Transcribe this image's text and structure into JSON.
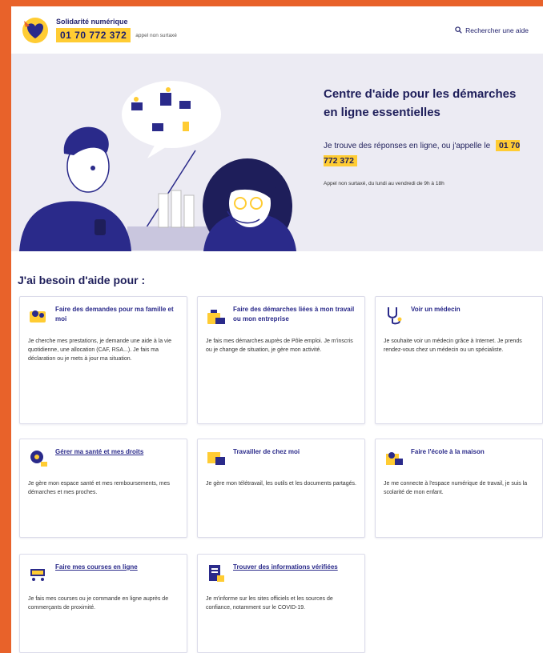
{
  "header": {
    "brand_title": "Solidarité numérique",
    "phone": "01 70 772 372",
    "phone_note": "appel non surtaxé",
    "search_link": "Rechercher une aide"
  },
  "hero": {
    "title": "Centre d'aide pour les démarches en ligne essentielles",
    "sub_before": "Je trouve des réponses en ligne, ou j'appelle le",
    "phone": "01 70 772 372",
    "small": "Appel non surtaxé, du lundi au vendredi de 9h à 18h"
  },
  "section": {
    "title": "J'ai besoin d'aide pour :"
  },
  "cards": [
    {
      "icon": "family-icon",
      "title": "Faire des demandes pour ma famille et moi",
      "desc": "Je cherche mes prestations, je demande une aide à la vie quotidienne, une allocation (CAF, RSA...). Je fais ma déclaration ou je mets à jour ma situation."
    },
    {
      "icon": "work-icon",
      "title": "Faire des démarches liées à mon travail ou mon entreprise",
      "desc": "Je fais mes démarches auprès de Pôle emploi. Je m'inscris ou je change de situation, je gère mon activité."
    },
    {
      "icon": "stethoscope-icon",
      "title": "Voir un médecin",
      "desc": "Je souhaite voir un médecin grâce à Internet. Je prends rendez-vous chez un médecin ou un spécialiste."
    },
    {
      "icon": "health-icon",
      "title": "Gérer ma santé et mes droits",
      "desc": "Je gère mon espace santé et mes remboursements, mes démarches et mes proches."
    },
    {
      "icon": "laptop-icon",
      "title": "Travailler de chez moi",
      "desc": "Je gère mon télétravail, les outils et les documents partagés."
    },
    {
      "icon": "school-icon",
      "title": "Faire l'école à la maison",
      "desc": "Je me connecte à l'espace numérique de travail, je suis la scolarité de mon enfant."
    },
    {
      "icon": "cart-icon",
      "title": "Faire mes courses en ligne",
      "desc": "Je fais mes courses ou je commande en ligne auprès de commerçants de proximité."
    },
    {
      "icon": "info-doc-icon",
      "title": "Trouver des informations vérifiées",
      "desc": "Je m'informe sur les sites officiels et les sources de confiance, notamment sur le COVID-19."
    }
  ]
}
